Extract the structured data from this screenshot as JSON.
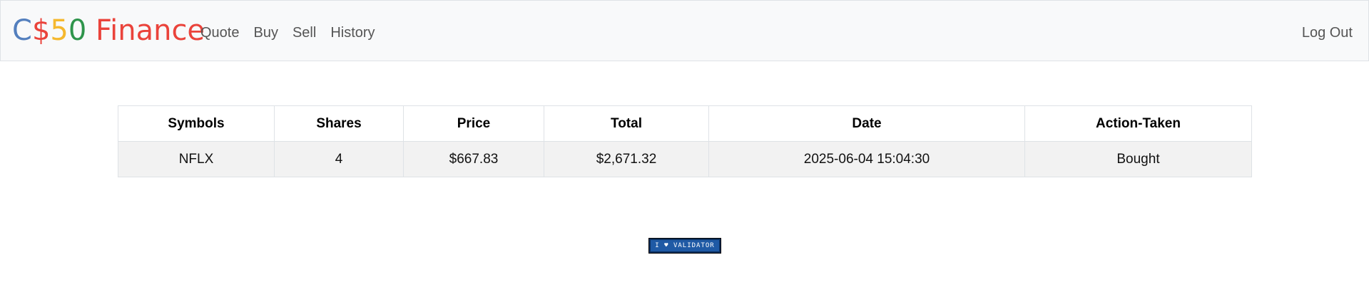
{
  "brand": {
    "part1": "C",
    "part2": "$",
    "part3": "5",
    "part4": "0",
    "part5": " Finance",
    "colors": {
      "blue": "#537fbe",
      "red": "#ea433b",
      "yellow": "#f5b82e",
      "green": "#2e944b"
    }
  },
  "nav": {
    "items": [
      {
        "label": "Quote"
      },
      {
        "label": "Buy"
      },
      {
        "label": "Sell"
      },
      {
        "label": "History"
      }
    ],
    "logout": "Log Out"
  },
  "history_table": {
    "headers": [
      "Symbols",
      "Shares",
      "Price",
      "Total",
      "Date",
      "Action-Taken"
    ],
    "rows": [
      [
        "NFLX",
        "4",
        "$667.83",
        "$2,671.32",
        "2025-06-04 15:04:30",
        "Bought"
      ]
    ]
  },
  "footer": {
    "validator_badge": "I ♥ VALIDATOR"
  }
}
